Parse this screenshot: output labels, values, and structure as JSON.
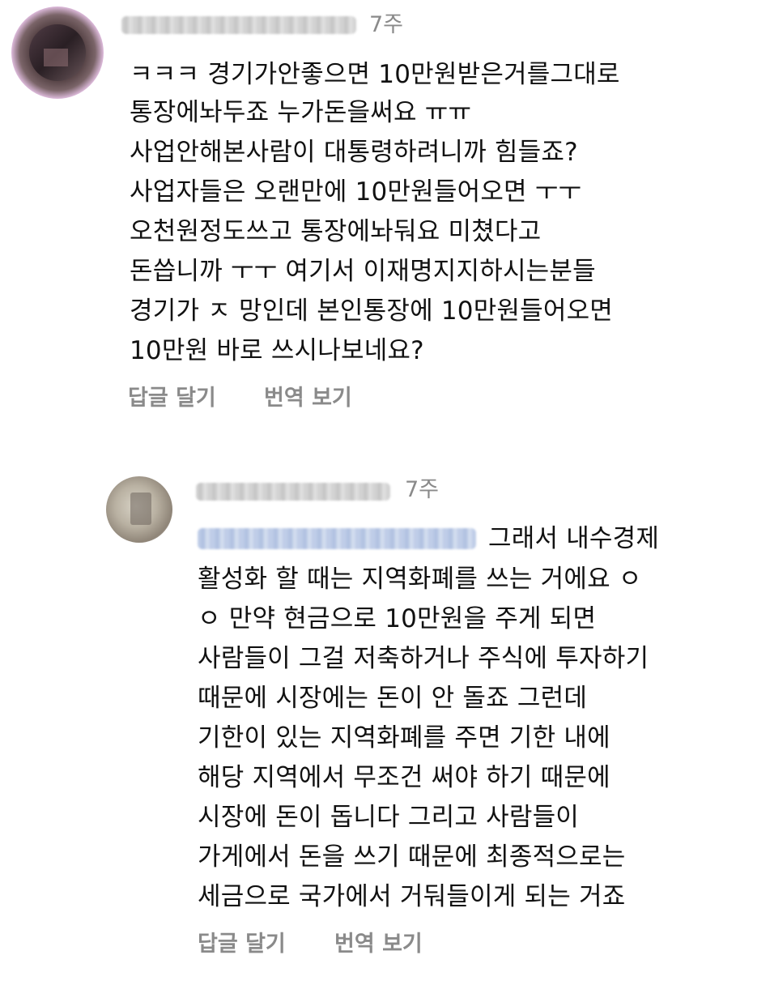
{
  "comments": [
    {
      "time": "7주",
      "lines": [
        "ㅋㅋㅋ 경기가안좋으면 10만원받은거를그대로",
        "통장에놔두죠 누가돈을써요 ㅠㅠ",
        "사업안해본사람이 대통령하려니까 힘들죠?",
        "사업자들은 오랜만에 10만원들어오면 ㅜㅜ",
        "오천원정도쓰고 통장에놔둬요 미쳤다고",
        "돈씁니까 ㅜㅜ 여기서 이재명지지하시는분들",
        "경기가 ㅈ 망인데 본인통장에 10만원들어오면",
        "10만원 바로 쓰시나보네요?"
      ],
      "reply_label": "답글 달기",
      "translate_label": "번역 보기"
    },
    {
      "time": "7주",
      "lines": [
        "그래서 내수경제",
        "활성화 할 때는 지역화폐를 쓰는 거에요 ㅇ",
        "ㅇ 만약 현금으로 10만원을 주게 되면",
        "사람들이 그걸 저축하거나 주식에 투자하기",
        "때문에 시장에는 돈이 안 돌죠 그런데",
        "기한이 있는 지역화폐를 주면 기한 내에",
        "해당 지역에서 무조건 써야 하기 때문에",
        "시장에 돈이 돕니다 그리고 사람들이",
        "가게에서 돈을 쓰기 때문에 최종적으로는",
        "세금으로 국가에서 거둬들이게 되는 거죠"
      ],
      "reply_label": "답글 달기",
      "translate_label": "번역 보기"
    }
  ]
}
